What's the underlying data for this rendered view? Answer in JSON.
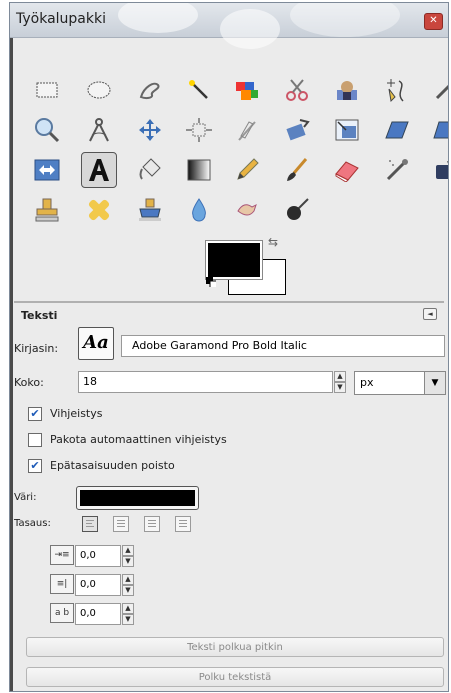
{
  "window": {
    "title": "Työkalupakki",
    "close_label": "✕"
  },
  "toolbox": {
    "tools": [
      {
        "name": "rect-select-icon"
      },
      {
        "name": "ellipse-select-icon"
      },
      {
        "name": "free-select-icon"
      },
      {
        "name": "fuzzy-select-icon"
      },
      {
        "name": "color-select-icon"
      },
      {
        "name": "scissors-select-icon"
      },
      {
        "name": "foreground-select-icon"
      },
      {
        "name": "paths-icon"
      },
      {
        "name": "color-picker-icon"
      },
      {
        "name": "zoom-icon"
      },
      {
        "name": "measure-icon"
      },
      {
        "name": "move-icon"
      },
      {
        "name": "align-icon"
      },
      {
        "name": "crop-icon"
      },
      {
        "name": "rotate-icon"
      },
      {
        "name": "scale-icon"
      },
      {
        "name": "shear-icon"
      },
      {
        "name": "perspective-icon"
      },
      {
        "name": "flip-icon"
      },
      {
        "name": "text-tool-icon",
        "active": true
      },
      {
        "name": "bucket-fill-icon"
      },
      {
        "name": "blend-icon"
      },
      {
        "name": "pencil-icon"
      },
      {
        "name": "paintbrush-icon"
      },
      {
        "name": "eraser-icon"
      },
      {
        "name": "airbrush-icon"
      },
      {
        "name": "ink-icon"
      },
      {
        "name": "clone-icon"
      },
      {
        "name": "heal-icon"
      },
      {
        "name": "perspective-clone-icon"
      },
      {
        "name": "blur-sharpen-icon"
      },
      {
        "name": "smudge-icon"
      },
      {
        "name": "dodge-burn-icon"
      }
    ],
    "foreground_color": "#000000",
    "background_color": "#ffffff"
  },
  "options": {
    "title": "Teksti",
    "font_label": "Kirjasin:",
    "font_preview": "Aa",
    "font_value": "Adobe Garamond Pro Bold Italic",
    "size_label": "Koko:",
    "size_value": "18",
    "unit_value": "px",
    "checkboxes": [
      {
        "label": "Vihjeistys",
        "checked": true
      },
      {
        "label": "Pakota automaattinen vihjeistys",
        "checked": false
      },
      {
        "label": "Epätasaisuuden poisto",
        "checked": true
      }
    ],
    "color_label": "Väri:",
    "text_color": "#000000",
    "justify_label": "Tasaus:",
    "indent_value": "0,0",
    "line_spacing_value": "0,0",
    "letter_spacing_value": "0,0",
    "button_text_along_path": "Teksti polkua pitkin",
    "button_path_from_text": "Polku tekstistä"
  }
}
